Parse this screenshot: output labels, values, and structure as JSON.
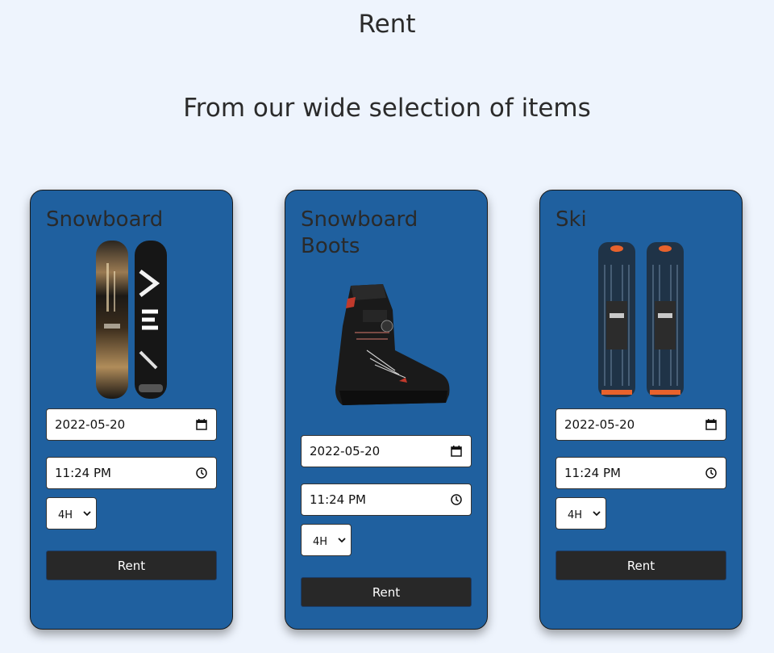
{
  "header": {
    "title": "Rent",
    "subtitle": "From our wide selection of items"
  },
  "colors": {
    "background": "#eef4fd",
    "card": "#1f609f",
    "button": "#282828",
    "text": "#2b2b2b"
  },
  "items": [
    {
      "title": "Snowboard",
      "image_icon": "snowboard-image",
      "date_value": "2022-05-20",
      "time_value": "11:24 PM",
      "duration_value": "4H",
      "rent_label": "Rent"
    },
    {
      "title": "Snowboard Boots",
      "image_icon": "snowboard-boot-image",
      "date_value": "2022-05-20",
      "time_value": "11:24 PM",
      "duration_value": "4H",
      "rent_label": "Rent"
    },
    {
      "title": "Ski",
      "image_icon": "ski-image",
      "date_value": "2022-05-20",
      "time_value": "11:24 PM",
      "duration_value": "4H",
      "rent_label": "Rent"
    }
  ]
}
